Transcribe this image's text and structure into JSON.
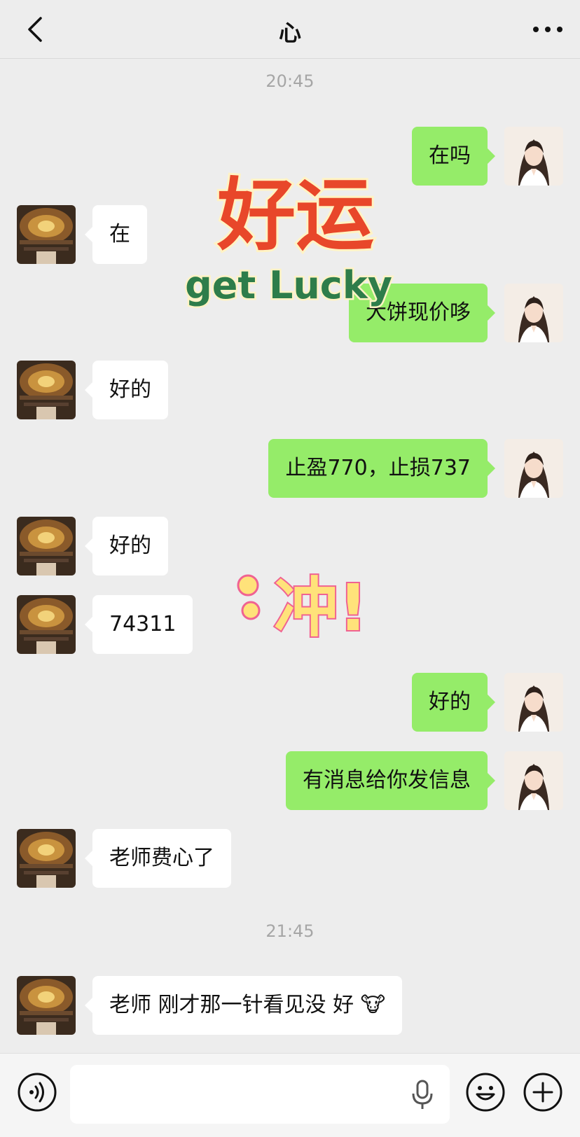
{
  "header": {
    "title": "心",
    "back_icon": "chevron-left-icon",
    "more_icon": "more-horizontal-icon"
  },
  "timestamps": [
    "20:45",
    "21:45"
  ],
  "messages": [
    {
      "sender": "me",
      "text": "在吗"
    },
    {
      "sender": "contact",
      "text": "在"
    },
    {
      "sender": "me",
      "text": "大饼现价哆"
    },
    {
      "sender": "contact",
      "text": "好的"
    },
    {
      "sender": "me",
      "text": "止盈770，止损737"
    },
    {
      "sender": "contact",
      "text": "好的"
    },
    {
      "sender": "contact",
      "text": "74311"
    },
    {
      "sender": "me",
      "text": "好的"
    },
    {
      "sender": "me",
      "text": "有消息给你发信息"
    },
    {
      "sender": "contact",
      "text": "老师费心了"
    },
    {
      "sender": "contact",
      "text": "老师 刚才那一针看见没 好 🐮"
    }
  ],
  "stickers": {
    "good_luck": {
      "line1": "好运",
      "line2": "get Lucky",
      "colors": [
        "#e8472a",
        "#2e7d4a"
      ]
    },
    "charge": {
      "text": "冲!",
      "color": "#f06292"
    }
  },
  "input_bar": {
    "placeholder": "",
    "icons": [
      "voice-icon",
      "mic-icon",
      "emoji-icon",
      "plus-icon"
    ]
  },
  "colors": {
    "background": "#ededed",
    "bubble_out": "#95ec69",
    "bubble_in": "#ffffff",
    "timestamp": "#a6a6a6"
  }
}
